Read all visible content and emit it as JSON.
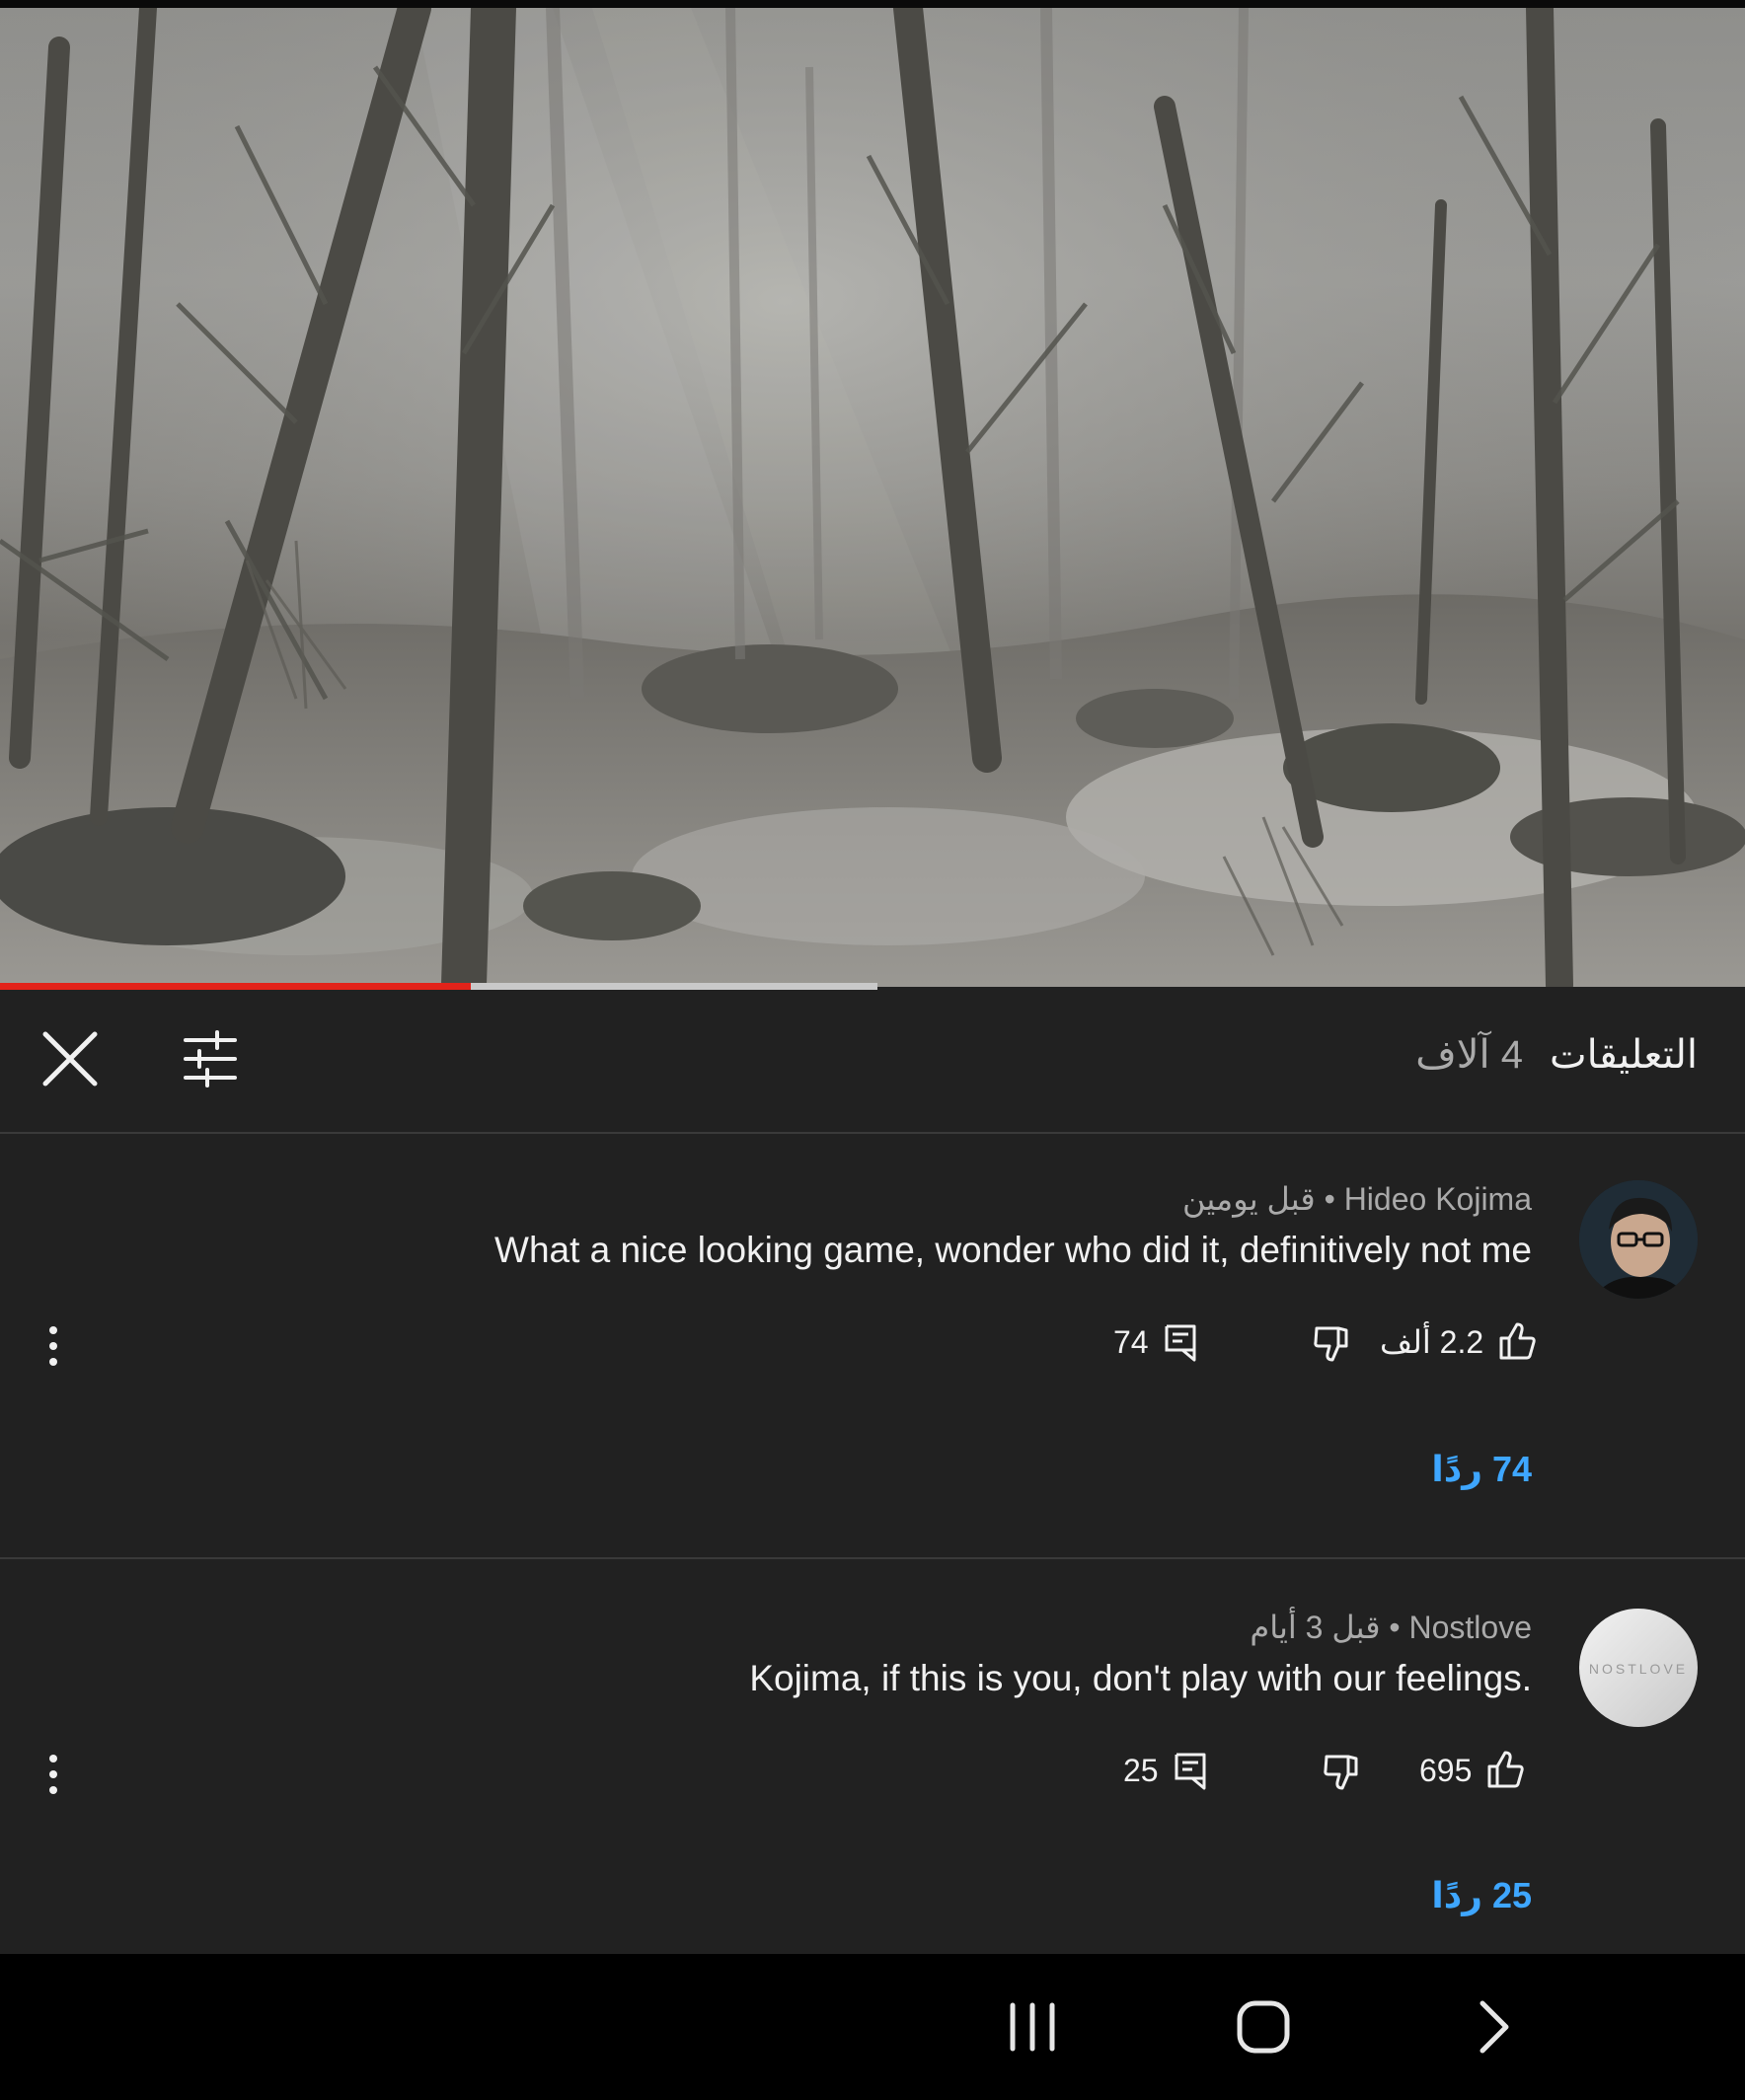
{
  "header": {
    "title": "التعليقات",
    "count": "4 آلاف"
  },
  "video": {
    "progress_played_fraction": 0.27,
    "progress_buffered_fraction": 0.503
  },
  "comments": [
    {
      "author": "Hideo Kojima",
      "separator": "•",
      "time": "قبل يومين",
      "text": "What a nice looking game, wonder who did it, definitively not me",
      "likes": "2.2 ألف",
      "reply_count": "74",
      "replies_link": "74 ردًا"
    },
    {
      "author": "Nostlove",
      "separator": "•",
      "time": "قبل 3 أيام",
      "text": "Kojima, if this is you, don't play with our feelings.",
      "likes": "695",
      "reply_count": "25",
      "replies_link": "25 ردًا",
      "avatar_text": "NOSTLOVE"
    }
  ],
  "icons": {
    "close": "close-icon",
    "filter": "sliders-icon",
    "like": "thumbs-up-icon",
    "dislike": "thumbs-down-icon",
    "reply": "comment-icon",
    "more": "more-vertical-icon",
    "nav_recents": "recent-apps-icon",
    "nav_home": "home-icon",
    "nav_back": "back-icon"
  },
  "colors": {
    "background": "#212121",
    "accent_progress": "#e2231a",
    "link": "#3ea6ff"
  }
}
